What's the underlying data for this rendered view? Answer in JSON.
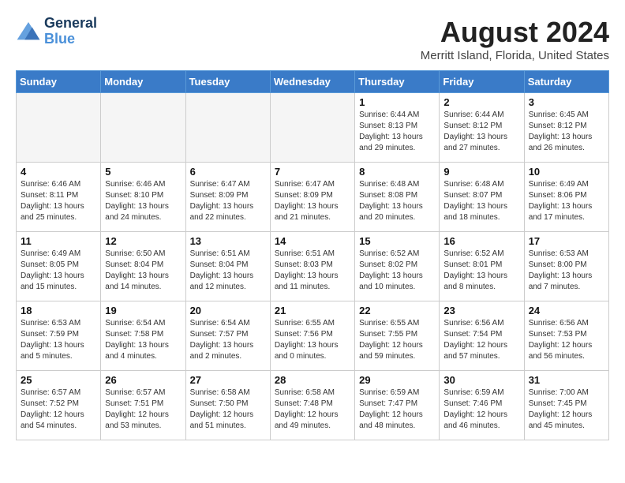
{
  "logo": {
    "line1": "General",
    "line2": "Blue"
  },
  "title": "August 2024",
  "location": "Merritt Island, Florida, United States",
  "days_of_week": [
    "Sunday",
    "Monday",
    "Tuesday",
    "Wednesday",
    "Thursday",
    "Friday",
    "Saturday"
  ],
  "weeks": [
    [
      {
        "day": "",
        "info": ""
      },
      {
        "day": "",
        "info": ""
      },
      {
        "day": "",
        "info": ""
      },
      {
        "day": "",
        "info": ""
      },
      {
        "day": "1",
        "info": "Sunrise: 6:44 AM\nSunset: 8:13 PM\nDaylight: 13 hours\nand 29 minutes."
      },
      {
        "day": "2",
        "info": "Sunrise: 6:44 AM\nSunset: 8:12 PM\nDaylight: 13 hours\nand 27 minutes."
      },
      {
        "day": "3",
        "info": "Sunrise: 6:45 AM\nSunset: 8:12 PM\nDaylight: 13 hours\nand 26 minutes."
      }
    ],
    [
      {
        "day": "4",
        "info": "Sunrise: 6:46 AM\nSunset: 8:11 PM\nDaylight: 13 hours\nand 25 minutes."
      },
      {
        "day": "5",
        "info": "Sunrise: 6:46 AM\nSunset: 8:10 PM\nDaylight: 13 hours\nand 24 minutes."
      },
      {
        "day": "6",
        "info": "Sunrise: 6:47 AM\nSunset: 8:09 PM\nDaylight: 13 hours\nand 22 minutes."
      },
      {
        "day": "7",
        "info": "Sunrise: 6:47 AM\nSunset: 8:09 PM\nDaylight: 13 hours\nand 21 minutes."
      },
      {
        "day": "8",
        "info": "Sunrise: 6:48 AM\nSunset: 8:08 PM\nDaylight: 13 hours\nand 20 minutes."
      },
      {
        "day": "9",
        "info": "Sunrise: 6:48 AM\nSunset: 8:07 PM\nDaylight: 13 hours\nand 18 minutes."
      },
      {
        "day": "10",
        "info": "Sunrise: 6:49 AM\nSunset: 8:06 PM\nDaylight: 13 hours\nand 17 minutes."
      }
    ],
    [
      {
        "day": "11",
        "info": "Sunrise: 6:49 AM\nSunset: 8:05 PM\nDaylight: 13 hours\nand 15 minutes."
      },
      {
        "day": "12",
        "info": "Sunrise: 6:50 AM\nSunset: 8:04 PM\nDaylight: 13 hours\nand 14 minutes."
      },
      {
        "day": "13",
        "info": "Sunrise: 6:51 AM\nSunset: 8:04 PM\nDaylight: 13 hours\nand 12 minutes."
      },
      {
        "day": "14",
        "info": "Sunrise: 6:51 AM\nSunset: 8:03 PM\nDaylight: 13 hours\nand 11 minutes."
      },
      {
        "day": "15",
        "info": "Sunrise: 6:52 AM\nSunset: 8:02 PM\nDaylight: 13 hours\nand 10 minutes."
      },
      {
        "day": "16",
        "info": "Sunrise: 6:52 AM\nSunset: 8:01 PM\nDaylight: 13 hours\nand 8 minutes."
      },
      {
        "day": "17",
        "info": "Sunrise: 6:53 AM\nSunset: 8:00 PM\nDaylight: 13 hours\nand 7 minutes."
      }
    ],
    [
      {
        "day": "18",
        "info": "Sunrise: 6:53 AM\nSunset: 7:59 PM\nDaylight: 13 hours\nand 5 minutes."
      },
      {
        "day": "19",
        "info": "Sunrise: 6:54 AM\nSunset: 7:58 PM\nDaylight: 13 hours\nand 4 minutes."
      },
      {
        "day": "20",
        "info": "Sunrise: 6:54 AM\nSunset: 7:57 PM\nDaylight: 13 hours\nand 2 minutes."
      },
      {
        "day": "21",
        "info": "Sunrise: 6:55 AM\nSunset: 7:56 PM\nDaylight: 13 hours\nand 0 minutes."
      },
      {
        "day": "22",
        "info": "Sunrise: 6:55 AM\nSunset: 7:55 PM\nDaylight: 12 hours\nand 59 minutes."
      },
      {
        "day": "23",
        "info": "Sunrise: 6:56 AM\nSunset: 7:54 PM\nDaylight: 12 hours\nand 57 minutes."
      },
      {
        "day": "24",
        "info": "Sunrise: 6:56 AM\nSunset: 7:53 PM\nDaylight: 12 hours\nand 56 minutes."
      }
    ],
    [
      {
        "day": "25",
        "info": "Sunrise: 6:57 AM\nSunset: 7:52 PM\nDaylight: 12 hours\nand 54 minutes."
      },
      {
        "day": "26",
        "info": "Sunrise: 6:57 AM\nSunset: 7:51 PM\nDaylight: 12 hours\nand 53 minutes."
      },
      {
        "day": "27",
        "info": "Sunrise: 6:58 AM\nSunset: 7:50 PM\nDaylight: 12 hours\nand 51 minutes."
      },
      {
        "day": "28",
        "info": "Sunrise: 6:58 AM\nSunset: 7:48 PM\nDaylight: 12 hours\nand 49 minutes."
      },
      {
        "day": "29",
        "info": "Sunrise: 6:59 AM\nSunset: 7:47 PM\nDaylight: 12 hours\nand 48 minutes."
      },
      {
        "day": "30",
        "info": "Sunrise: 6:59 AM\nSunset: 7:46 PM\nDaylight: 12 hours\nand 46 minutes."
      },
      {
        "day": "31",
        "info": "Sunrise: 7:00 AM\nSunset: 7:45 PM\nDaylight: 12 hours\nand 45 minutes."
      }
    ]
  ]
}
